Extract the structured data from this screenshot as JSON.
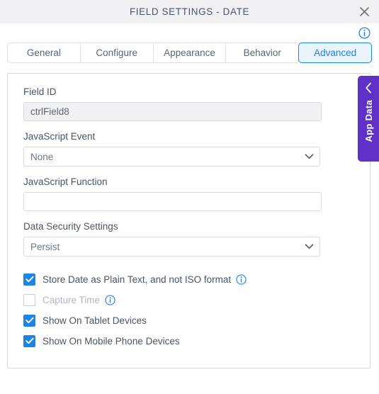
{
  "window": {
    "title": "FIELD SETTINGS - DATE",
    "close_icon": "close-icon",
    "help_icon": "info-icon"
  },
  "tabs": [
    {
      "label": "General",
      "active": false
    },
    {
      "label": "Configure",
      "active": false
    },
    {
      "label": "Appearance",
      "active": false
    },
    {
      "label": "Behavior",
      "active": false
    },
    {
      "label": "Advanced",
      "active": true
    }
  ],
  "form": {
    "field_id": {
      "label": "Field ID",
      "value": "ctrlField8",
      "placeholder": ""
    },
    "javascript_event": {
      "label": "JavaScript Event",
      "value": "None"
    },
    "javascript_function": {
      "label": "JavaScript Function",
      "value": "",
      "placeholder": ""
    },
    "data_security_settings": {
      "label": "Data Security Settings",
      "value": "Persist"
    },
    "checkboxes": [
      {
        "label": "Store Date as Plain Text, and not ISO format",
        "checked": true,
        "disabled": false,
        "has_info": true
      },
      {
        "label": "Capture Time",
        "checked": false,
        "disabled": true,
        "has_info": true
      },
      {
        "label": "Show On Tablet Devices",
        "checked": true,
        "disabled": false,
        "has_info": false
      },
      {
        "label": "Show On Mobile Phone Devices",
        "checked": true,
        "disabled": false,
        "has_info": false
      }
    ]
  },
  "side_panel": {
    "label": "App Data",
    "chevron_icon": "chevron-left-icon",
    "color": "#6031c8"
  },
  "colors": {
    "accent": "#1b84e7",
    "titlebar_bg": "#f1f1f3",
    "border": "#d6d9e0",
    "text": "#4a5366",
    "app_data_purple": "#6031c8"
  }
}
